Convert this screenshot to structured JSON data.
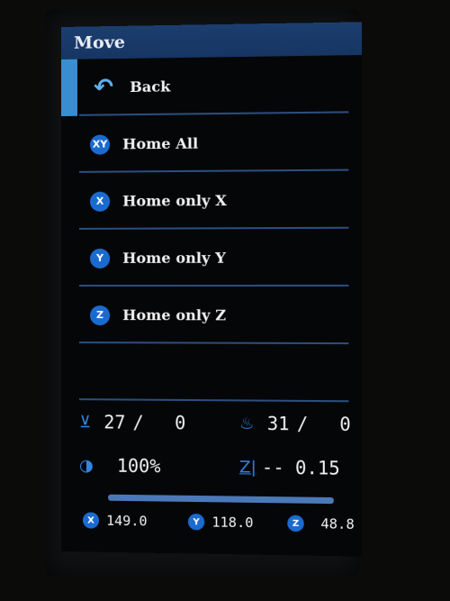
{
  "title": "Move",
  "menu": {
    "back": {
      "label": "Back",
      "icon": "back-arrow-icon"
    },
    "items": [
      {
        "label": "Home All",
        "icon": "home-all-icon",
        "glyph": "XY"
      },
      {
        "label": "Home only X",
        "icon": "home-x-icon",
        "glyph": "X"
      },
      {
        "label": "Home only Y",
        "icon": "home-y-icon",
        "glyph": "Y"
      },
      {
        "label": "Home only Z",
        "icon": "home-z-icon",
        "glyph": "Z"
      }
    ]
  },
  "status": {
    "hotend": {
      "current": "27",
      "sep": "/",
      "target": "0",
      "icon": "hotend-icon"
    },
    "bed": {
      "current": "31",
      "sep": "/",
      "target": "0",
      "icon": "bed-heat-icon"
    },
    "fan": {
      "value": "100%",
      "icon": "fan-icon"
    },
    "z_offset": {
      "value": "-- 0.15",
      "icon": "z-offset-icon",
      "label": "Z|"
    },
    "progress": 1.0,
    "x": {
      "value": "149.0",
      "glyph": "X"
    },
    "y": {
      "value": "118.0",
      "glyph": "Y"
    },
    "z": {
      "value": "48.8",
      "glyph": "Z"
    }
  },
  "colors": {
    "accent": "#3a8dd1",
    "title_bar": "#163563",
    "divider": "#2b4f7e",
    "icon_blue": "#1a6bd0"
  }
}
